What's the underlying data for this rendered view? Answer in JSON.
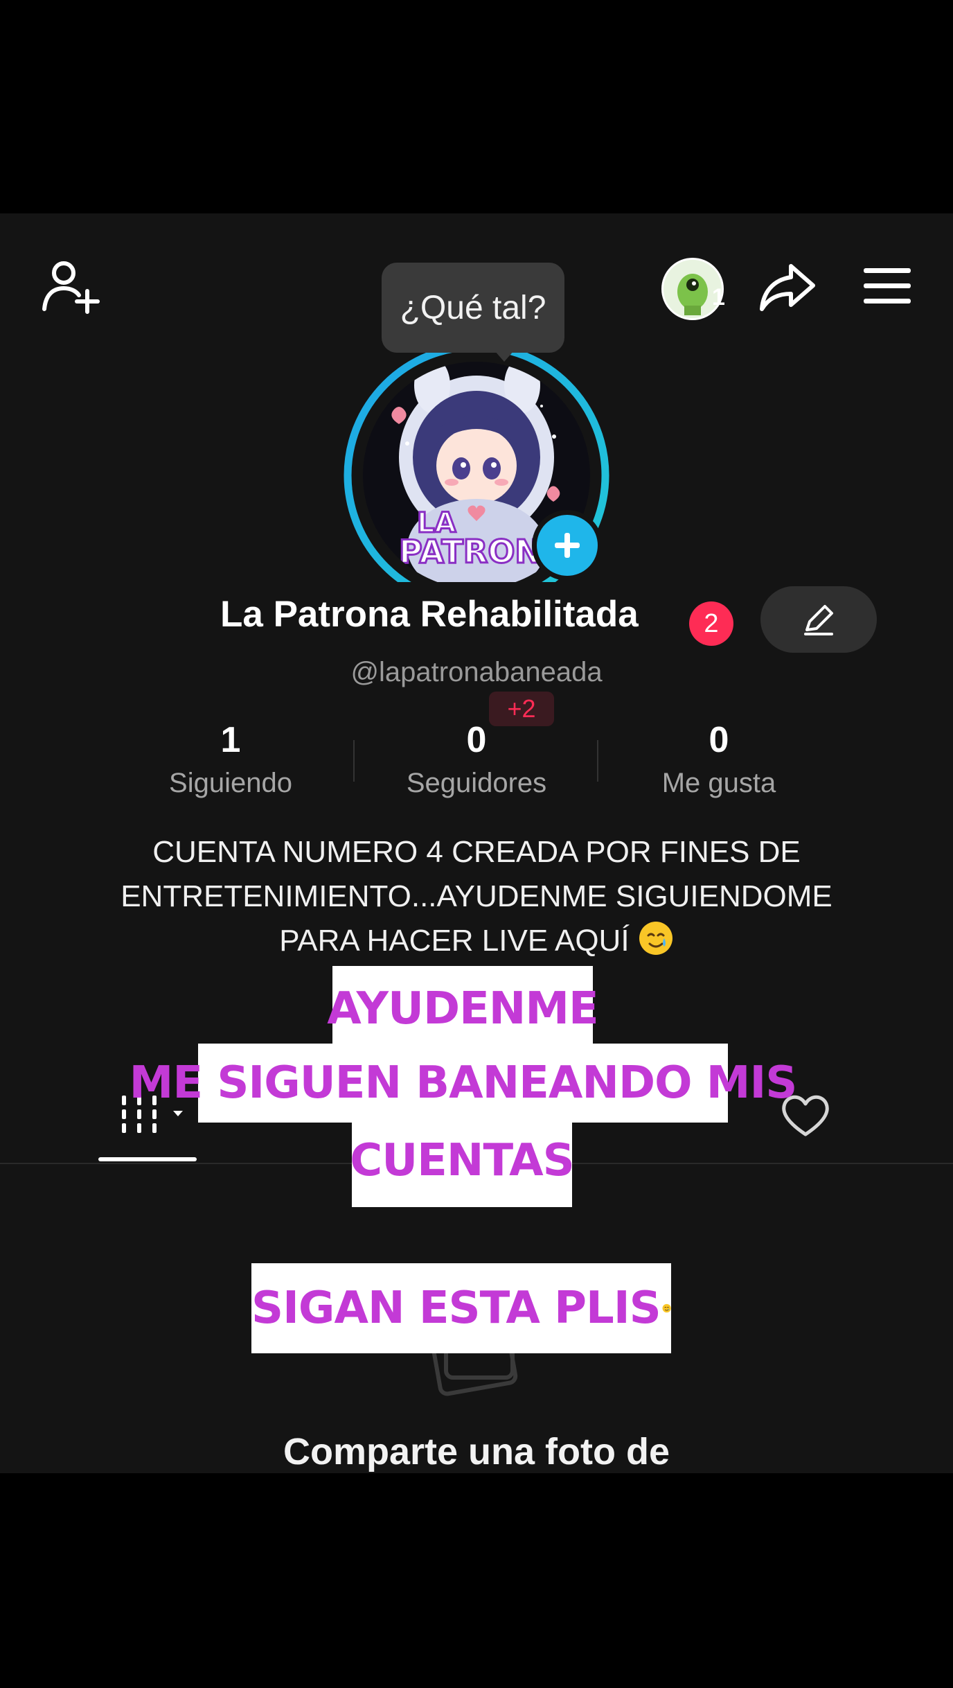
{
  "tooltip": {
    "text": "¿Qué tal?"
  },
  "header": {
    "friends_count": "1"
  },
  "profile": {
    "display_name": "La Patrona Rehabilitada",
    "name_badge": "2",
    "username": "@lapatronabaneada",
    "new_followers_badge": "+2",
    "avatar_lettering": "LA PATRONA"
  },
  "stats": [
    {
      "value": "1",
      "label": "Siguiendo"
    },
    {
      "value": "0",
      "label": "Seguidores"
    },
    {
      "value": "0",
      "label": "Me gusta"
    }
  ],
  "bio": {
    "line1": "CUENTA NUMERO 4 CREADA POR FINES DE",
    "line2": "ENTRETENIMIENTO...AYUDENME SIGUIENDOME",
    "line3": "PARA HACER LIVE AQUÍ"
  },
  "stickers": {
    "line1": "AYUDENME",
    "line2": "ME SIGUEN BANEANDO MIS",
    "line3": "CUENTAS",
    "line4": "SIGAN ESTA PLIS"
  },
  "empty_state": {
    "title": "Comparte una foto de"
  },
  "colors": {
    "background": "#141414",
    "accent_red": "#fe2c55",
    "accent_cyan": "#1fb6ea",
    "sticker_text": "#c33ad6"
  },
  "icons": {
    "add_friend": "person-plus-icon",
    "share": "share-arrow-icon",
    "menu": "hamburger-menu-icon",
    "edit": "pencil-icon",
    "grid_tab": "grid-icon",
    "liked_tab": "heart-icon"
  }
}
